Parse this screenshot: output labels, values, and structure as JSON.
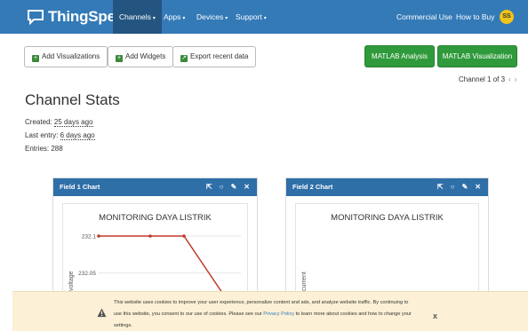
{
  "navbar": {
    "brand": "ThingSpeak",
    "trademark": "™",
    "items": [
      {
        "label": "Channels",
        "dropdown": true,
        "active": true
      },
      {
        "label": "Apps",
        "dropdown": true
      },
      {
        "label": "Devices",
        "dropdown": true
      },
      {
        "label": "Support",
        "dropdown": true
      }
    ],
    "right_items": [
      {
        "label": "Commercial Use"
      },
      {
        "label": "How to Buy"
      }
    ],
    "avatar_initials": "SS"
  },
  "toolbar": {
    "add_visualizations": "Add Visualizations",
    "add_widgets": "Add Widgets",
    "export_recent_data": "Export recent data",
    "matlab_analysis": "MATLAB Analysis",
    "matlab_visualization": "MATLAB Visualization"
  },
  "pager": {
    "label": "Channel 1 of 3",
    "prev": "‹",
    "next": "›"
  },
  "channel_stats": {
    "title": "Channel Stats",
    "created_label": "Created:",
    "created_value": "25 days ago",
    "last_entry_label": "Last entry:",
    "last_entry_value": "6 days ago",
    "entries": "Entries: 288"
  },
  "panels": [
    {
      "header": "Field 1 Chart",
      "chart_title": "MONITORING DAYA LISTRIK",
      "ylabel": "voltage"
    },
    {
      "header": "Field 2 Chart",
      "chart_title": "MONITORING DAYA LISTRIK",
      "ylabel": "current"
    }
  ],
  "chart_data": [
    {
      "type": "line",
      "title": "MONITORING DAYA LISTRIK",
      "ylabel": "voltage",
      "yticks": [
        232.1,
        232.05
      ],
      "series": [
        {
          "values": [
            232.1,
            232.1,
            232.1,
            232.0
          ]
        }
      ]
    },
    {
      "type": "line",
      "title": "MONITORING DAYA LISTRIK",
      "ylabel": "current",
      "series": []
    }
  ],
  "cookie_banner": {
    "line1": "This website uses cookies to improve your user experience, personalize content and ads, and analyze website traffic. By continuing to",
    "line2_pre": "use this website, you consent to our use of cookies. Please see our ",
    "link": "Privacy Policy",
    "line2_post": " to learn more about cookies and how to change your",
    "line3": "settings.",
    "close": "x"
  },
  "colors": {
    "navbar": "#337ab7",
    "panel_header": "#2f6fa8",
    "matlab_button": "#2f9a3b",
    "chart_line": "#c0392b",
    "cookie_bg": "#fcf1d6"
  }
}
